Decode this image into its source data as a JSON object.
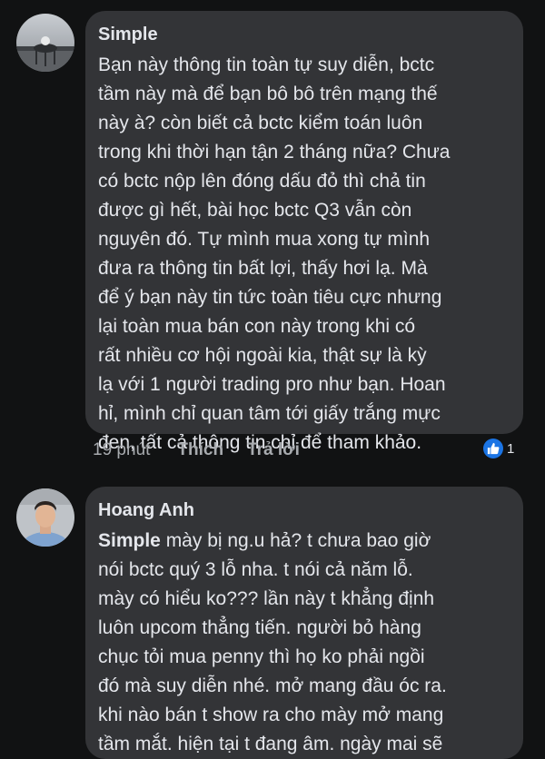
{
  "comments": [
    {
      "author": "Simple",
      "text": "Bạn này thông tin toàn tự suy diễn, bctc\ntầm này mà để bạn bô bô trên mạng thế\nnày à? còn biết cả bctc kiểm toán luôn\ntrong khi thời hạn tận 2 tháng nữa? Chưa\ncó bctc nộp lên đóng dấu đỏ thì chả tin\nđược gì hết, bài học bctc Q3 vẫn còn\nnguyên đó. Tự mình mua xong tự mình\nđưa ra thông tin bất lợi, thấy hơi lạ. Mà\nđể ý bạn này tin tức toàn tiêu cực nhưng\nlại toàn mua bán con này trong khi có\nrất nhiều cơ hội ngoài kia, thật sự là kỳ\nlạ với 1 người trading pro như bạn. Hoan\nhỉ, mình chỉ quan tâm tới giấy trắng mực\nđen, tất cả thông tin chỉ để tham khảo.",
      "time": "19 phút",
      "like_label": "Thích",
      "reply_label": "Trả lời",
      "reaction_count": "1",
      "reaction_icon": "thumbs-up-icon",
      "reaction_color": "#1b74e4"
    },
    {
      "author": "Hoang Anh",
      "mention": "Simple",
      "text": "  mày bị ng.u hả? t chưa bao giờ\nnói bctc quý 3 lỗ nha. t nói cả năm lỗ.\nmày có hiểu ko??? lần này t khẳng định\nluôn upcom thẳng tiến. người bỏ hàng\nchục tỏi mua penny thì họ ko phải ngồi\nđó mà suy diễn nhé. mở mang đầu óc ra.\nkhi nào bán t show ra cho mày mở mang\ntầm mắt. hiện tại t đang âm. ngày mai sẽ"
    }
  ],
  "colors": {
    "background": "#111213",
    "bubble": "#333437",
    "text": "#e4e6eb",
    "muted": "#a8abaf"
  }
}
